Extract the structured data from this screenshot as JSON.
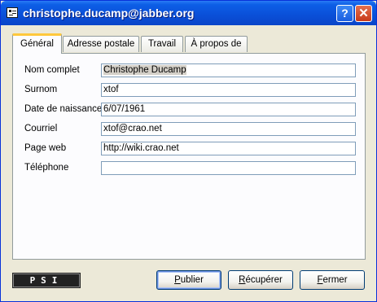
{
  "window": {
    "title": "christophe.ducamp@jabber.org",
    "help_button": "?",
    "close_button": "✕"
  },
  "tabs": [
    {
      "label": "Général",
      "active": true
    },
    {
      "label": "Adresse postale",
      "active": false
    },
    {
      "label": "Travail",
      "active": false
    },
    {
      "label": "À propos de",
      "active": false
    }
  ],
  "fields": {
    "full_name": {
      "label": "Nom complet",
      "value": "Christophe Ducamp"
    },
    "nickname": {
      "label": "Surnom",
      "value": "xtof"
    },
    "birthday": {
      "label": "Date de naissance",
      "value": "6/07/1961"
    },
    "email": {
      "label": "Courriel",
      "value": "xtof@crao.net"
    },
    "homepage": {
      "label": "Page web",
      "value": "http://wiki.crao.net"
    },
    "phone": {
      "label": "Téléphone",
      "value": ""
    }
  },
  "logo_text": "PSI",
  "buttons": {
    "publish": {
      "accel": "P",
      "rest": "ublier"
    },
    "retrieve": {
      "accel": "R",
      "rest": "écupérer"
    },
    "close": {
      "accel": "F",
      "rest": "ermer"
    }
  },
  "colors": {
    "titlebar": "#0a4fd8",
    "active_tab_accent": "#ffc83c",
    "window_background": "#ece9d8"
  },
  "icons": {
    "app": "card-icon",
    "help": "help-icon",
    "close": "close-icon"
  }
}
